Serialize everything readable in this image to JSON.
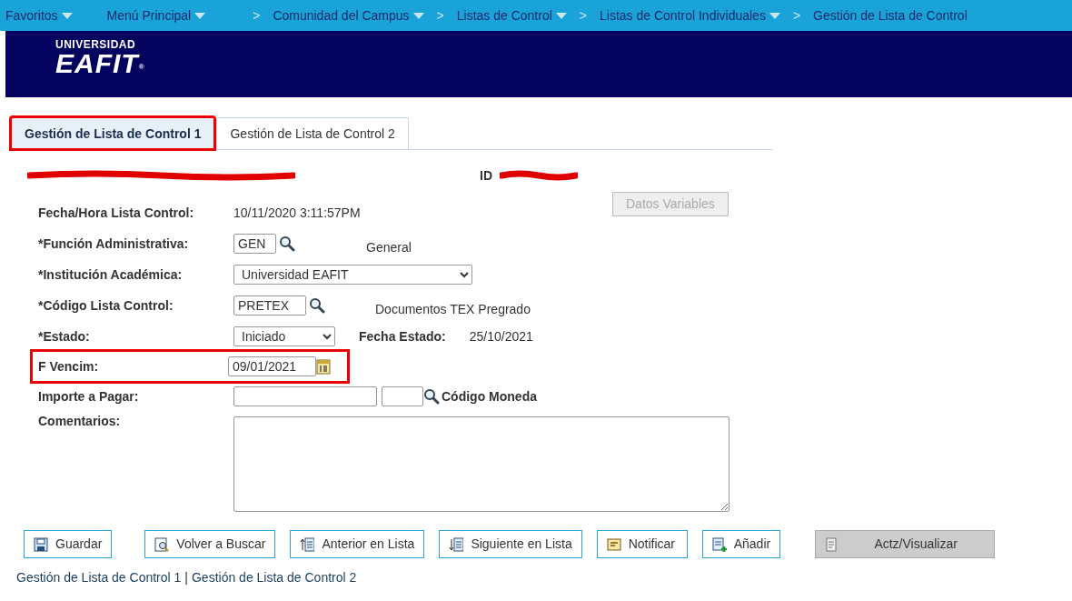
{
  "breadcrumb": [
    {
      "label": "Favoritos",
      "dropdown": true
    },
    {
      "label": "Menú Principal",
      "dropdown": true
    },
    {
      "label": "Comunidad del Campus",
      "dropdown": true,
      "separator": ">"
    },
    {
      "label": "Listas de Control",
      "dropdown": true,
      "separator": ">"
    },
    {
      "label": "Listas de Control Individuales",
      "dropdown": true,
      "separator": ">"
    },
    {
      "label": "Gestión de Lista de Control",
      "dropdown": false,
      "separator": ">"
    }
  ],
  "banner": {
    "logo_top": "UNIVERSIDAD",
    "logo_main": "EAFIT",
    "logo_mark": "®"
  },
  "tabs": [
    {
      "label": "Gestión de Lista de Control 1",
      "selected": true,
      "highlighted": true
    },
    {
      "label": "Gestión de Lista de Control 2",
      "selected": false,
      "highlighted": false
    }
  ],
  "header": {
    "name_redacted": true,
    "id_label": "ID",
    "id_redacted": true
  },
  "datos_button": {
    "label": "Datos Variables",
    "disabled": true
  },
  "fields": [
    {
      "kind": "static",
      "label": "Fecha/Hora Lista Control:",
      "value": "10/11/2020  3:11:57PM",
      "highlighted": false
    },
    {
      "kind": "lookup",
      "label": "*Función Administrativa:",
      "value": "GEN",
      "description": "General",
      "highlighted": false
    },
    {
      "kind": "select",
      "label": "*Institución Académica:",
      "value": "Universidad EAFIT",
      "highlighted": false
    },
    {
      "kind": "lookup",
      "label": "*Código Lista Control:",
      "value": "PRETEX",
      "description": "Documentos TEX Pregrado",
      "highlighted": false
    },
    {
      "kind": "status",
      "label": "*Estado:",
      "value": "Iniciado",
      "extra_label": "Fecha Estado:",
      "extra_value": "25/10/2021",
      "highlighted": false
    },
    {
      "kind": "date",
      "label": "F Vencim:",
      "value": "09/01/2021",
      "highlighted": true
    },
    {
      "kind": "amount",
      "label": "Importe a Pagar:",
      "currency_label": "Código Moneda",
      "highlighted": false
    },
    {
      "kind": "textarea",
      "label": "Comentarios:",
      "highlighted": false
    }
  ],
  "buttons": [
    {
      "label": "Guardar",
      "disabled": false
    },
    {
      "label": "Volver a Buscar",
      "disabled": false
    },
    {
      "label": "Anterior en Lista",
      "disabled": false
    },
    {
      "label": "Siguiente en Lista",
      "disabled": false
    },
    {
      "label": "Notificar",
      "disabled": false
    },
    {
      "label": "Añadir",
      "disabled": false
    },
    {
      "label": "Actz/Visualizar",
      "disabled": true
    }
  ],
  "footer_links": [
    "Gestión de Lista de Control 1",
    "Gestión de Lista de Control 2"
  ],
  "footer_separator": "|"
}
